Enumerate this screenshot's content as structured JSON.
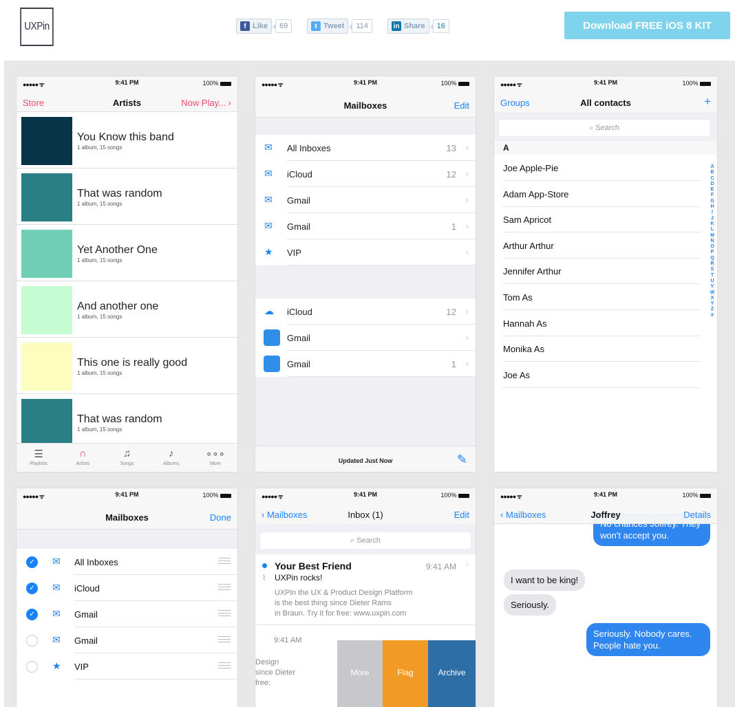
{
  "header": {
    "logo": "UXPin",
    "like": {
      "label": "Like",
      "count": "69"
    },
    "tweet": {
      "label": "Tweet",
      "count": "114"
    },
    "share": {
      "label": "Share",
      "count": "16"
    },
    "download": "Download FREE iOS 8 KIT"
  },
  "status": {
    "signal": "●●●●● ᯤ",
    "time": "9:41 PM",
    "battery": "100%"
  },
  "music": {
    "nav": {
      "left": "Store",
      "title": "Artists",
      "right": "Now Play... ›"
    },
    "artists": [
      {
        "title": "You Know this band",
        "sub": "1 album, 15 songs",
        "color": "#083447"
      },
      {
        "title": "That was random",
        "sub": "1 album, 15 songs",
        "color": "#2a7f84"
      },
      {
        "title": "Yet Another One",
        "sub": "1 album, 15 songs",
        "color": "#71cfb7"
      },
      {
        "title": "And another one",
        "sub": "1 album, 15 songs",
        "color": "#c6fcd2"
      },
      {
        "title": "This one is really good",
        "sub": "1 album, 15 songs",
        "color": "#fdfdc0"
      },
      {
        "title": "That was random",
        "sub": "1 album, 15 songs",
        "color": "#2a7f84"
      }
    ],
    "tabs": [
      "Playlists",
      "Artists",
      "Songs",
      "Albums",
      "More"
    ]
  },
  "mailboxes": {
    "nav": {
      "title": "Mailboxes",
      "right": "Edit"
    },
    "rows": [
      {
        "label": "All Inboxes",
        "count": "13"
      },
      {
        "label": "iCloud",
        "count": "12"
      },
      {
        "label": "Gmail",
        "count": ""
      },
      {
        "label": "Gmail",
        "count": "1"
      },
      {
        "label": "VIP",
        "count": ""
      }
    ],
    "accounts": [
      {
        "label": "iCloud",
        "count": "12"
      },
      {
        "label": "Gmail",
        "count": ""
      },
      {
        "label": "Gmail",
        "count": "1"
      }
    ],
    "footer": "Updated Just Now"
  },
  "contacts": {
    "nav": {
      "left": "Groups",
      "title": "All contacts",
      "right": "+"
    },
    "search": "Search",
    "section": "A",
    "rows": [
      "Joe Apple-Pie",
      "Adam App-Store",
      "Sam Apricot",
      "Arthur Arthur",
      "Jennifer Arthur",
      "Tom As",
      "Hannah As",
      "Monika As",
      "Joe As"
    ],
    "index": "ABCDEFGHIJKLMNOPQRSTUVWXYZ#"
  },
  "editmail": {
    "nav": {
      "title": "Mailboxes",
      "right": "Done"
    },
    "rows": [
      {
        "label": "All Inboxes",
        "checked": true
      },
      {
        "label": "iCloud",
        "checked": true
      },
      {
        "label": "Gmail",
        "checked": true
      },
      {
        "label": "Gmail",
        "checked": false
      },
      {
        "label": "VIP",
        "checked": false
      }
    ]
  },
  "inbox": {
    "nav": {
      "left": "‹ Mailboxes",
      "title": "Inbox (1)",
      "right": "Edit"
    },
    "search": "Search",
    "sender": "Your Best Friend",
    "time": "9:41 AM",
    "subject": "UXPin rocks!",
    "preview1": "UXPin the UX & Product Design Platform",
    "preview2": "is the best thing since Dieter Rams",
    "preview3": "in Braun. Try it for free: www.uxpin.com",
    "time2": "9:41 AM",
    "snippet1": "Design",
    "snippet2": "since Dieter",
    "snippet3": "free:",
    "actions": [
      "More",
      "Flag",
      "Archive"
    ]
  },
  "messages": {
    "nav": {
      "left": "‹ Mailboxes",
      "title": "Joffrey",
      "right": "Details"
    },
    "bubbles": [
      {
        "text": "No chances Joffrey. They won't accept you.",
        "dir": "out"
      },
      {
        "text": "I want to be king!",
        "dir": "in"
      },
      {
        "text": "Seriously.",
        "dir": "in"
      },
      {
        "text": "Seriously. Nobody cares. People hate you.",
        "dir": "out"
      }
    ]
  }
}
